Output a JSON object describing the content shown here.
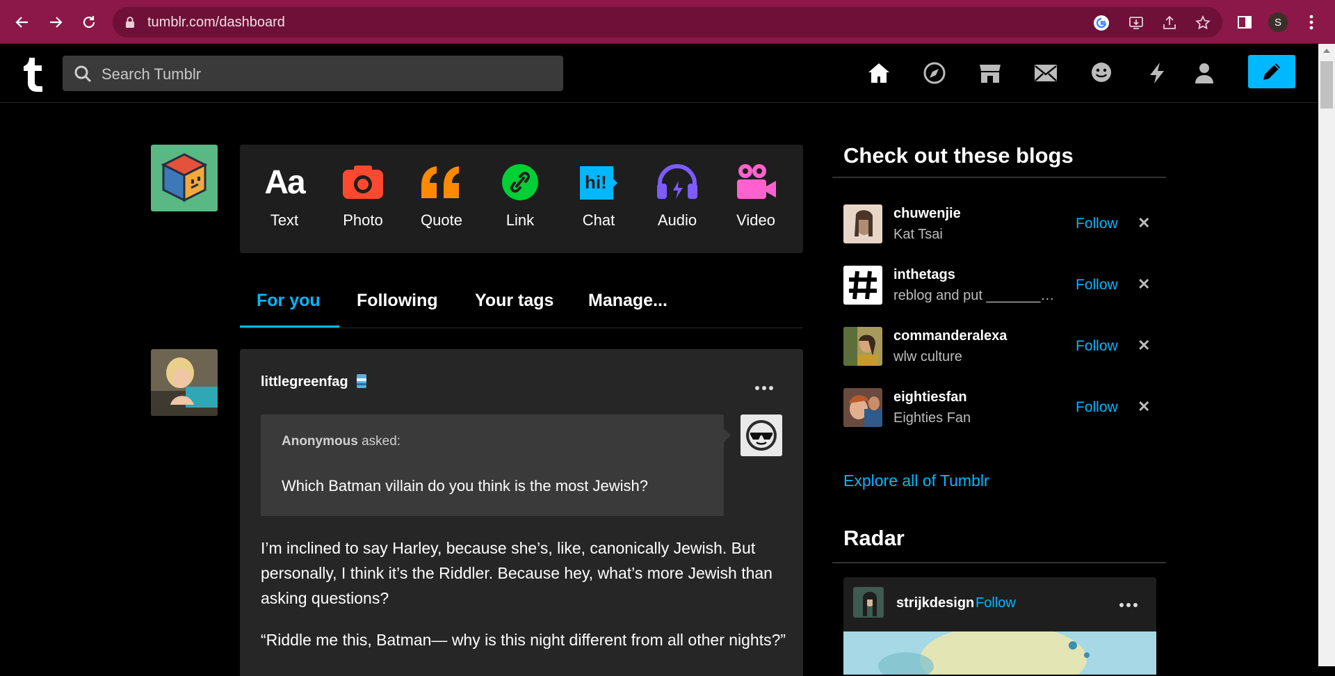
{
  "browser": {
    "url": "tumblr.com/dashboard",
    "profile_initial": "S"
  },
  "header": {
    "search_placeholder": "Search Tumblr"
  },
  "post_types": [
    {
      "label": "Text",
      "icon": "text-icon",
      "color": "#ffffff"
    },
    {
      "label": "Photo",
      "icon": "camera-icon",
      "color": "#ff492f"
    },
    {
      "label": "Quote",
      "icon": "quote-icon",
      "color": "#ff8a00"
    },
    {
      "label": "Link",
      "icon": "link-icon",
      "color": "#00cf35"
    },
    {
      "label": "Chat",
      "icon": "chat-icon",
      "color": "#00b8ff"
    },
    {
      "label": "Audio",
      "icon": "headphones-icon",
      "color": "#7c5cff"
    },
    {
      "label": "Video",
      "icon": "video-camera-icon",
      "color": "#ff62ce"
    }
  ],
  "tabs": [
    {
      "label": "For you",
      "active": true
    },
    {
      "label": "Following",
      "active": false
    },
    {
      "label": "Your tags",
      "active": false
    },
    {
      "label": "Manage...",
      "active": false
    }
  ],
  "post": {
    "author": "littlegreenfag",
    "ask_from": "Anonymous",
    "ask_verb": "asked:",
    "question": "Which Batman villain do you think is the most Jewish?",
    "answer_1": "I’m inclined to say Harley, because she’s, like, canonically Jewish. But personally, I think it’s the Riddler. Because hey, what’s more Jewish than asking questions?",
    "answer_2": "“Riddle me this, Batman— why is this night different from all other nights?”"
  },
  "sidebar": {
    "title": "Check out these blogs",
    "follow_label": "Follow",
    "blogs": [
      {
        "name": "chuwenjie",
        "subtitle": "Kat Tsai"
      },
      {
        "name": "inthetags",
        "subtitle": "reblog and put ________..."
      },
      {
        "name": "commanderalexa",
        "subtitle": "wlw culture"
      },
      {
        "name": "eightiesfan",
        "subtitle": "Eighties Fan"
      }
    ],
    "explore_label": "Explore all of Tumblr",
    "radar_title": "Radar",
    "radar": {
      "name": "strijkdesign",
      "follow_label": "Follow"
    }
  },
  "colors": {
    "accent": "#00b8ff",
    "browser_bar": "#8b1848",
    "background": "#000000",
    "card": "#262626"
  }
}
